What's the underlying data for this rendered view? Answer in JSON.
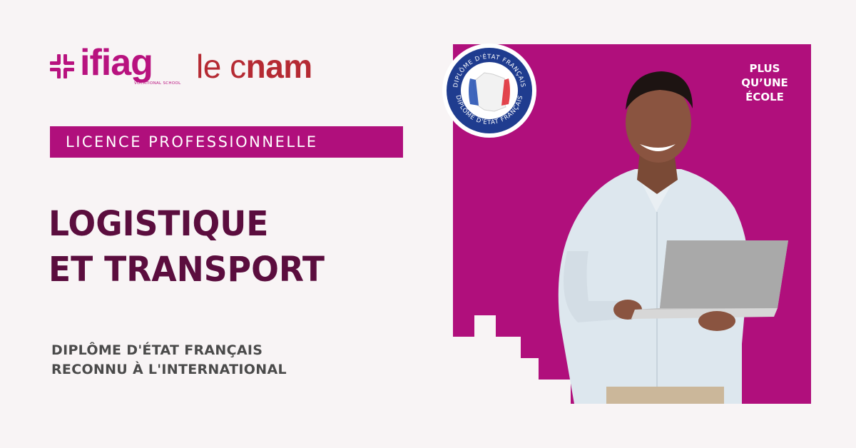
{
  "logos": {
    "ifiag": {
      "name": "ifiag",
      "tagline": "VOCATIONAL SCHOOL"
    },
    "cnam": {
      "prefix": "le c",
      "bold": "nam"
    }
  },
  "band": {
    "label": "LICENCE PROFESSIONNELLE"
  },
  "title": {
    "line1": "LOGISTIQUE",
    "line2": "ET TRANSPORT"
  },
  "subtitle": {
    "line1": "DIPLÔME D'ÉTAT FRANÇAIS",
    "line2": "RECONNU À L'INTERNATIONAL"
  },
  "tagline": {
    "line1": "PLUS",
    "line2": "QU’UNE",
    "line3": "ÉCOLE"
  },
  "seal": {
    "text": "DIPLÔME D'ÉTAT FRANÇAIS"
  },
  "colors": {
    "brand_magenta": "#b00f7c",
    "title_purple": "#5b0d3e",
    "cnam_red": "#b52a33",
    "seal_blue": "#1f3c8f"
  }
}
